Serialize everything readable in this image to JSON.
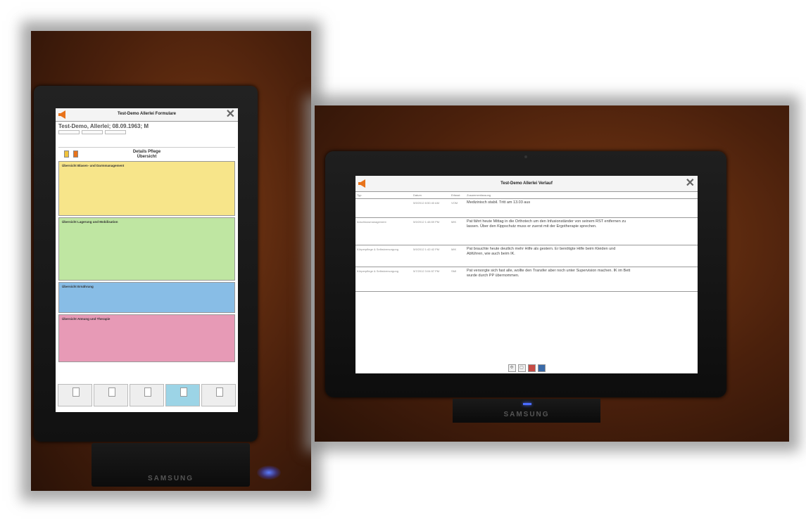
{
  "left_device": {
    "title": "Test-Demo Allerlei Formulare",
    "patient_name": "Test-Demo, Allerlei; 08.09.1963; M",
    "detail_heading_1": "Details Pflege",
    "detail_heading_2": "Übersicht",
    "sections": {
      "s1_title": "Übersicht Blasen- und Darmmanagement",
      "s2_title": "Übersicht Lagerung und Mobilisation",
      "s3_title": "Übersicht Ernährung",
      "s4_title": "Übersicht Atmung und Therapie"
    },
    "brand": "SAMSUNG"
  },
  "right_device": {
    "title": "Test-Demo Allerlei Verlauf",
    "columns": {
      "c1": "Typ",
      "c2": "Datum",
      "c3": "Erfasst",
      "c4": "Zusammenfassung"
    },
    "entries": [
      {
        "date": "5/9/2012 8:50:40 AM",
        "user": "VOM",
        "text": "Medizinisch stabil. Tritt am 13.03 aus"
      },
      {
        "type": "Anschlussmanagement",
        "date": "5/9/2012 1:48:59 PM",
        "user": "MIK",
        "text": "Pat fährt heute Mittag in die Orthotech um den Infusionständer von seinem RST entfernen zu lassen. Über den Kippschutz muss er zuerst mit der Ergotherapie sprechen."
      },
      {
        "type": "Körperpflege & Selbstversorgung",
        "date": "5/9/2012 1:42:42 PM",
        "user": "MIK",
        "text": "Pat brauchte heute deutlich mehr Hilfe als gestern. Er benötigte Hilfe beim Kleiden und Abführen, wie auch beim IK."
      },
      {
        "type": "Körperpflege & Selbstversorgung",
        "date": "5/7/2012 3:04:57 PM",
        "user": "SMI",
        "text": "Pat versorgte sich fast alle, wollte den Transfer aber noch unter Supervision machen. IK im Bett wurde durch PP übernommen."
      }
    ],
    "brand": "SAMSUNG"
  }
}
